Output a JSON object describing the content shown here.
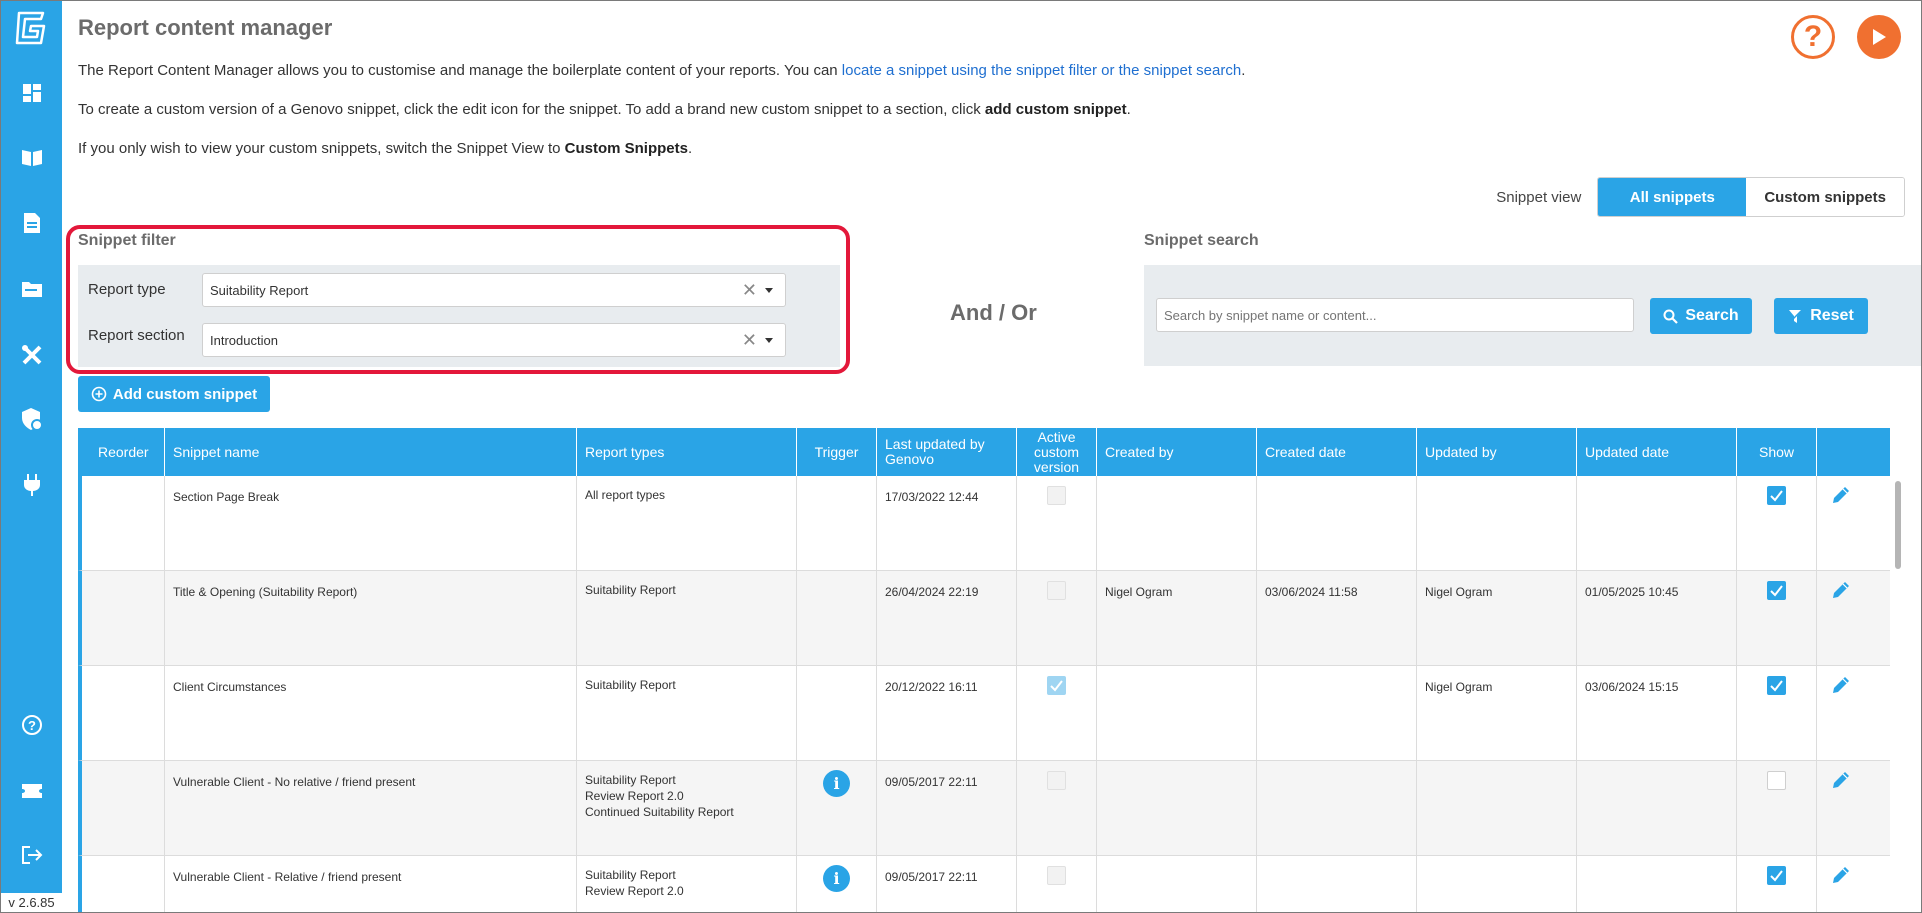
{
  "app": {
    "version": "v 2.6.85"
  },
  "sidebar": {
    "items": [
      {
        "icon": "logo-icon"
      },
      {
        "icon": "dashboard-icon"
      },
      {
        "icon": "book-icon"
      },
      {
        "icon": "document-icon"
      },
      {
        "icon": "folder-icon"
      },
      {
        "icon": "tools-icon"
      },
      {
        "icon": "shield-settings-icon"
      },
      {
        "icon": "plug-icon"
      },
      {
        "icon": "help-icon"
      },
      {
        "icon": "ticket-icon"
      },
      {
        "icon": "logout-icon"
      }
    ]
  },
  "header": {
    "title": "Report content manager",
    "help_icon": "help-circle-icon",
    "play_icon": "play-icon"
  },
  "intro": {
    "line1_prefix": "The Report Content Manager allows you to customise and manage the boilerplate content of your reports. You can ",
    "line1_link": "locate a snippet using the snippet filter or the snippet search",
    "line1_suffix": ".",
    "line2_prefix": "To create a custom version of a Genovo snippet, click the edit icon for the snippet. To add a brand new custom snippet to a section, click ",
    "line2_bold": "add custom snippet",
    "line2_suffix": ".",
    "line3_prefix": "If you only wish to view your custom snippets, switch the Snippet View to ",
    "line3_bold": "Custom Snippets",
    "line3_suffix": "."
  },
  "snippet_view": {
    "label": "Snippet view",
    "options": [
      "All snippets",
      "Custom snippets"
    ],
    "selected": "All snippets"
  },
  "filter": {
    "title": "Snippet filter",
    "report_type_label": "Report type",
    "report_type_value": "Suitability Report",
    "report_section_label": "Report section",
    "report_section_value": "Introduction"
  },
  "and_or": "And / Or",
  "search": {
    "title": "Snippet search",
    "placeholder": "Search by snippet name or content...",
    "search_label": "Search",
    "reset_label": "Reset"
  },
  "add_button": "Add custom snippet",
  "table": {
    "headers": {
      "reorder": "Reorder",
      "name": "Snippet name",
      "types": "Report types",
      "trigger": "Trigger",
      "last_updated_line1": "Last updated by",
      "last_updated_line2": "Genovo",
      "active_line1": "Active",
      "active_line2": "custom",
      "active_line3": "version",
      "created_by": "Created by",
      "created_date": "Created date",
      "updated_by": "Updated by",
      "updated_date": "Updated date",
      "show": "Show"
    },
    "rows": [
      {
        "name": "Section Page Break",
        "types": [
          "All report types"
        ],
        "trigger": false,
        "last_updated": "17/03/2022 12:44",
        "active": "disabled",
        "created_by": "",
        "created_date": "",
        "updated_by": "",
        "updated_date": "",
        "show": true
      },
      {
        "name": "Title & Opening (Suitability Report)",
        "types": [
          "Suitability Report"
        ],
        "trigger": false,
        "last_updated": "26/04/2024 22:19",
        "active": "disabled",
        "created_by": "Nigel Ogram",
        "created_date": "03/06/2024 11:58",
        "updated_by": "Nigel Ogram",
        "updated_date": "01/05/2025 10:45",
        "show": true
      },
      {
        "name": "Client Circumstances",
        "types": [
          "Suitability Report"
        ],
        "trigger": false,
        "last_updated": "20/12/2022 16:11",
        "active": "disabled-checked",
        "created_by": "",
        "created_date": "",
        "updated_by": "Nigel Ogram",
        "updated_date": "03/06/2024 15:15",
        "show": true
      },
      {
        "name": "Vulnerable Client - No relative / friend present",
        "types": [
          "Suitability Report",
          "Review Report 2.0",
          "Continued Suitability Report"
        ],
        "trigger": true,
        "last_updated": "09/05/2017 22:11",
        "active": "disabled",
        "created_by": "",
        "created_date": "",
        "updated_by": "",
        "updated_date": "",
        "show": false
      },
      {
        "name": "Vulnerable Client - Relative / friend present",
        "types": [
          "Suitability Report",
          "Review Report 2.0"
        ],
        "trigger": true,
        "last_updated": "09/05/2017 22:11",
        "active": "disabled",
        "created_by": "",
        "created_date": "",
        "updated_by": "",
        "updated_date": "",
        "show": true
      }
    ]
  },
  "colors": {
    "accent": "#2aa4e6",
    "orange": "#f07030",
    "highlight": "#e3183a"
  }
}
